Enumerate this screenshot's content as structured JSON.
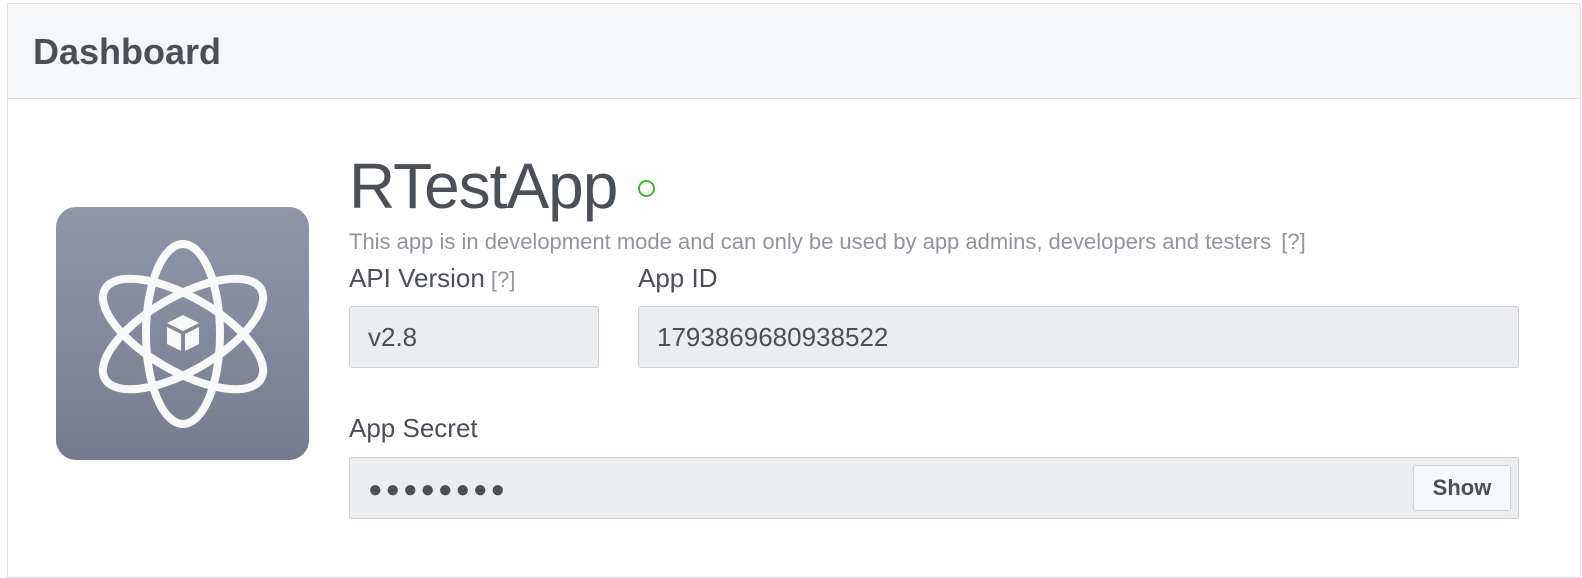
{
  "header": {
    "title": "Dashboard"
  },
  "app": {
    "name": "RTestApp",
    "icon": "atom-icon",
    "status_color": "#42b72a",
    "dev_notice": "This app is in development mode and can only be used by app admins, developers and testers",
    "dev_notice_help": "[?]"
  },
  "api_version": {
    "label": "API Version",
    "help": "[?]",
    "value": "v2.8"
  },
  "app_id": {
    "label": "App ID",
    "value": "1793869680938522"
  },
  "app_secret": {
    "label": "App Secret",
    "value": "●●●●●●●●",
    "show_label": "Show"
  }
}
